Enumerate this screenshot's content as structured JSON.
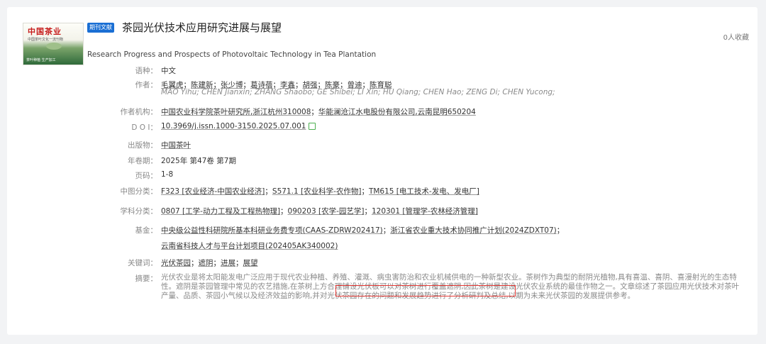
{
  "badge": "期刊文献",
  "title": "茶园光伏技术应用研究进展与展望",
  "favorites": "0人收藏",
  "title_en": "Research Progress and Prospects of Photovoltaic Technology in Tea Plantation",
  "cover": {
    "title": "中国茶业",
    "subtitle": "中国茶叶文化一流刊物",
    "footer": "茶叶种植 生产加工"
  },
  "labels": {
    "language": "语种：",
    "authors": "作者：",
    "org": "作者机构：",
    "doi": "D O I：",
    "publication": "出版物：",
    "year_issue": "年卷期：",
    "pages": "页码：",
    "clc": "中图分类：",
    "discipline": "学科分类：",
    "fund": "基金：",
    "keywords": "关键词：",
    "abstract": "摘要："
  },
  "language": "中文",
  "authors": [
    "毛翼虎",
    "陈建新",
    "张少博",
    "葛诗蓓",
    "李鑫",
    "胡强",
    "陈豪",
    "曾迪",
    "陈育聪"
  ],
  "authors_en": "MAO Yihu;  CHEN Jianxin;  ZHANG Shaobo;  GE Shibei;  LI Xin;  HU Qiang;  CHEN Hao;  ZENG Di;  CHEN Yucong;",
  "orgs": [
    "中国农业科学院茶叶研究所,浙江杭州310008",
    "华能澜沧江水电股份有限公司,云南昆明650204"
  ],
  "doi": "10.3969/j.issn.1000-3150.2025.07.001",
  "publication": "中国茶叶",
  "year_issue": "2025年 第47卷 第7期",
  "pages": "1-8",
  "clc": [
    "F323 [农业经济-中国农业经济]",
    "S571.1 [农业科学-农作物]",
    "TM615 [电工技术-发电、发电厂]"
  ],
  "discipline": [
    "0807 [工学-动力工程及工程热物理]",
    "090203 [农学-园艺学]",
    "120301 [管理学-农林经济管理]"
  ],
  "funds": [
    "中央级公益性科研院所基本科研业务费专项(CAAS-ZDRW202417)",
    "浙江省农业重大技术协同推广计划(2024ZDXT07)",
    "云南省科技人才与平台计划项目(202405AK340002)"
  ],
  "keywords": [
    "光伏茶园",
    "遮阴",
    "进展",
    "展望"
  ],
  "abstract": "光伏农业是将太阳能发电广泛应用于现代农业种植、养殖、灌溉、病虫害防治和农业机械供电的一种新型农业。茶树作为典型的耐阴光植物,具有喜温、喜阴、喜漫射光的生态特性。遮阴是茶园管理中常见的农艺措施,在茶树上方合理铺设光伏板可以对茶树进行覆盖遮阴,因此茶树是建设光伏农业系统的最佳作物之一。文章综述了茶园应用光伏技术对茶叶产量、品质、茶园小气候以及经济效益的影响,并对光伏茶园存在的问题和发展趋势进行了分析研判及总结,以期为未来光伏茶园的发展提供参考。"
}
